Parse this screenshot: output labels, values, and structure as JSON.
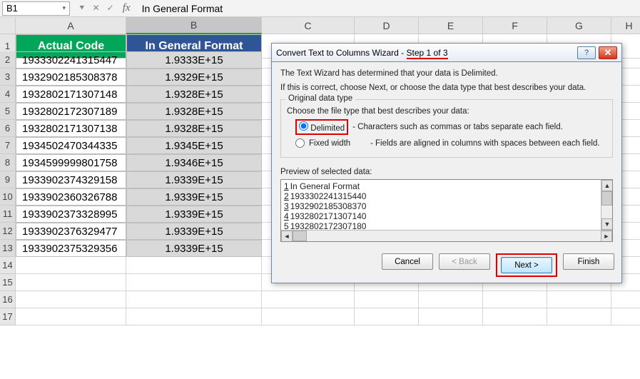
{
  "namebox": "B1",
  "formula_value": "In General Format",
  "fb_icons": {
    "down": "⯆",
    "cancel": "✕",
    "accept": "✓"
  },
  "columns": [
    "",
    "A",
    "B",
    "C",
    "D",
    "E",
    "F",
    "G",
    "H"
  ],
  "headers": {
    "a": "Actual Code",
    "b": "In General Format"
  },
  "rows": [
    {
      "n": "1"
    },
    {
      "n": "2",
      "a": "1933302241315447",
      "b": "1.9333E+15"
    },
    {
      "n": "3",
      "a": "1932902185308378",
      "b": "1.9329E+15"
    },
    {
      "n": "4",
      "a": "1932802171307148",
      "b": "1.9328E+15"
    },
    {
      "n": "5",
      "a": "1932802172307189",
      "b": "1.9328E+15"
    },
    {
      "n": "6",
      "a": "1932802171307138",
      "b": "1.9328E+15"
    },
    {
      "n": "7",
      "a": "1934502470344335",
      "b": "1.9345E+15"
    },
    {
      "n": "8",
      "a": "1934599999801758",
      "b": "1.9346E+15"
    },
    {
      "n": "9",
      "a": "1933902374329158",
      "b": "1.9339E+15"
    },
    {
      "n": "10",
      "a": "1933902360326788",
      "b": "1.9339E+15"
    },
    {
      "n": "11",
      "a": "1933902373328995",
      "b": "1.9339E+15"
    },
    {
      "n": "12",
      "a": "1933902376329477",
      "b": "1.9339E+15"
    },
    {
      "n": "13",
      "a": "1933902375329356",
      "b": "1.9339E+15"
    },
    {
      "n": "14"
    },
    {
      "n": "15"
    },
    {
      "n": "16"
    },
    {
      "n": "17"
    }
  ],
  "dialog": {
    "title_pre": "Convert Text to Columns Wizard - ",
    "title_step": "Step 1 of 3",
    "help": "?",
    "close": "✕",
    "line1": "The Text Wizard has determined that your data is Delimited.",
    "line2": "If this is correct, choose Next, or choose the data type that best describes your data.",
    "group_label": "Original data type",
    "choose": "Choose the file type that best describes your data:",
    "radio1": "Delimited",
    "radio1_desc": "- Characters such as commas or tabs separate each field.",
    "radio2": "Fixed width",
    "radio2_desc": "- Fields are aligned in columns with spaces between each field.",
    "preview_label": "Preview of selected data:",
    "preview": [
      {
        "n": "1",
        "t": "In General Format"
      },
      {
        "n": "2",
        "t": "1933302241315440"
      },
      {
        "n": "3",
        "t": "1932902185308370"
      },
      {
        "n": "4",
        "t": "1932802171307140"
      },
      {
        "n": "5",
        "t": "1932802172307180"
      }
    ],
    "buttons": {
      "cancel": "Cancel",
      "back": "< Back",
      "next": "Next >",
      "finish": "Finish"
    },
    "arrows": {
      "up": "▲",
      "down": "▼",
      "left": "◄",
      "right": "►"
    }
  }
}
